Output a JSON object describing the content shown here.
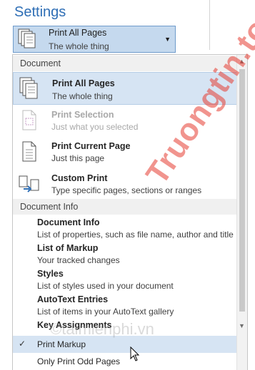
{
  "settings": {
    "heading": "Settings"
  },
  "print_range": {
    "title": "Print All Pages",
    "subtitle": "The whole thing"
  },
  "menu": {
    "document_section": "Document",
    "items": [
      {
        "title": "Print All Pages",
        "desc": "The whole thing",
        "icon": "pages-stack-icon"
      },
      {
        "title": "Print Selection",
        "desc": "Just what you selected",
        "icon": "selection-page-icon"
      },
      {
        "title": "Print Current Page",
        "desc": "Just this page",
        "icon": "single-page-icon"
      },
      {
        "title": "Custom Print",
        "desc": "Type specific pages, sections or ranges",
        "icon": "custom-print-icon"
      }
    ],
    "docinfo_section": "Document Info",
    "info_items": [
      {
        "title": "Document Info",
        "desc": "List of properties, such as file name, author and title"
      },
      {
        "title": "List of Markup",
        "desc": "Your tracked changes"
      },
      {
        "title": "Styles",
        "desc": "List of styles used in your document"
      },
      {
        "title": "AutoText Entries",
        "desc": "List of items in your AutoText gallery"
      },
      {
        "title": "Key Assignments",
        "desc": ""
      }
    ],
    "options": [
      {
        "label": "Print Markup",
        "checked": true,
        "check_mark": "✓"
      },
      {
        "label": "Only Print Odd Pages",
        "checked": false
      }
    ]
  },
  "watermark": {
    "text": "Truongtin.top",
    "secondary": "©taimienphi.vn"
  },
  "colors": {
    "accent": "#2e6eb5",
    "selected_bg": "#d6e4f3",
    "section_bg": "#f0f0f0"
  }
}
